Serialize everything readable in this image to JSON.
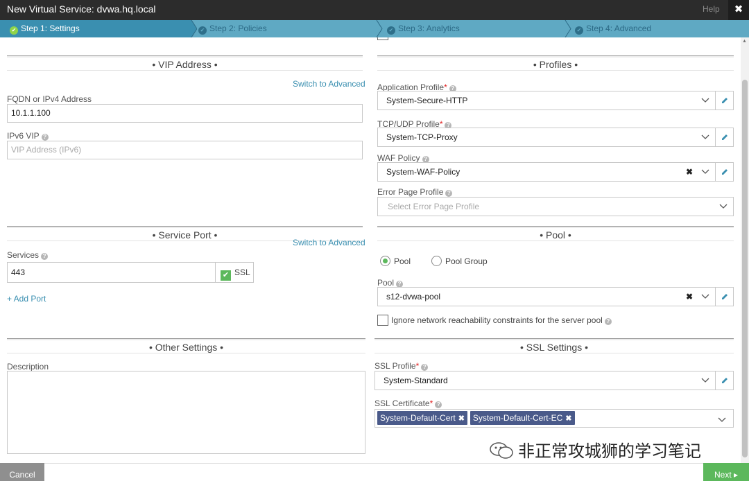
{
  "window": {
    "title": "New Virtual Service: dvwa.hq.local",
    "help_label": "Help",
    "close_glyph": "✖"
  },
  "steps": [
    {
      "label": "Step 1: Settings",
      "active": true
    },
    {
      "label": "Step 2: Policies",
      "active": false
    },
    {
      "label": "Step 3: Analytics",
      "active": false
    },
    {
      "label": "Step 4: Advanced",
      "active": false
    }
  ],
  "vip": {
    "header": "• VIP Address •",
    "switch_label": "Switch to Advanced",
    "fqdn_label": "FQDN or IPv4 Address",
    "fqdn_value": "10.1.1.100",
    "ipv6_label": "IPv6 VIP",
    "ipv6_placeholder": "VIP Address (IPv6)"
  },
  "profiles": {
    "header": "• Profiles •",
    "app_profile_label": "Application Profile",
    "app_profile_value": "System-Secure-HTTP",
    "tcp_profile_label": "TCP/UDP Profile",
    "tcp_profile_value": "System-TCP-Proxy",
    "waf_label": "WAF Policy",
    "waf_value": "System-WAF-Policy",
    "error_page_label": "Error Page Profile",
    "error_page_placeholder": "Select Error Page Profile"
  },
  "service_port": {
    "header": "• Service Port •",
    "switch_label": "Switch to Advanced",
    "services_label": "Services",
    "port_value": "443",
    "ssl_label": "SSL",
    "ssl_checked": true,
    "add_port_label": "+ Add Port"
  },
  "pool": {
    "header": "• Pool •",
    "radio_pool": "Pool",
    "radio_pool_group": "Pool Group",
    "selected": "Pool",
    "pool_label": "Pool",
    "pool_value": "s12-dvwa-pool",
    "ignore_label": "Ignore network reachability constraints for the server pool",
    "ignore_checked": false
  },
  "other": {
    "header": "• Other Settings •",
    "description_label": "Description",
    "description_value": ""
  },
  "ssl": {
    "header": "• SSL Settings •",
    "profile_label": "SSL Profile",
    "profile_value": "System-Standard",
    "cert_label": "SSL Certificate",
    "certs": [
      "System-Default-Cert",
      "System-Default-Cert-EC"
    ]
  },
  "watermark": "非正常攻城狮的学习笔记",
  "footer": {
    "cancel_label": "Cancel",
    "next_label": "Next"
  },
  "colors": {
    "accent": "#3a8fb0",
    "success": "#5cb85c",
    "tag": "#4a5a8a",
    "required": "#e02020"
  }
}
